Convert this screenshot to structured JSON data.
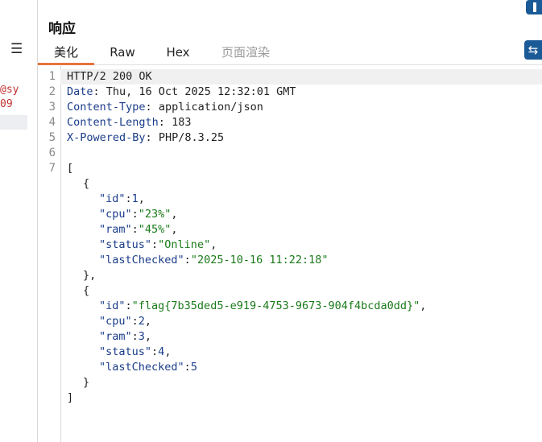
{
  "left_panel": {
    "menu_icon": "☰",
    "fragment_1": "@sy",
    "fragment_2": "09"
  },
  "header": {
    "title": "响应",
    "tabs": [
      {
        "label": "美化",
        "active": true
      },
      {
        "label": "Raw",
        "active": false
      },
      {
        "label": "Hex",
        "active": false
      },
      {
        "label": "页面渲染",
        "active": false,
        "disabled": true
      }
    ]
  },
  "accent_color": "#e8743b",
  "button_color": "#1a5a96",
  "editor": {
    "line_numbers": [
      "1",
      "2",
      "3",
      "4",
      "5",
      "6",
      "7"
    ],
    "headers": [
      {
        "name": "HTTP/2 200 OK",
        "value": ""
      },
      {
        "name": "Date",
        "value": "Thu, 16 Oct 2025 12:32:01 GMT"
      },
      {
        "name": "Content-Type",
        "value": "application/json"
      },
      {
        "name": "Content-Length",
        "value": "183"
      },
      {
        "name": "X-Powered-By",
        "value": "PHP/8.3.25"
      }
    ],
    "body": {
      "open_bracket": "[",
      "close_bracket": "]",
      "open_brace": "{",
      "close_brace_comma": "},",
      "close_brace": "}",
      "items": [
        {
          "id_key": "\"id\"",
          "id_val": "1",
          "cpu_key": "\"cpu\"",
          "cpu_val": "\"23%\"",
          "ram_key": "\"ram\"",
          "ram_val": "\"45%\"",
          "status_key": "\"status\"",
          "status_val": "\"Online\"",
          "lc_key": "\"lastChecked\"",
          "lc_val": "\"2025-10-16 11:22:18\""
        },
        {
          "id_key": "\"id\"",
          "id_val": "\"flag{7b35ded5-e919-4753-9673-904f4bcda0dd}\"",
          "cpu_key": "\"cpu\"",
          "cpu_val": "2",
          "ram_key": "\"ram\"",
          "ram_val": "3",
          "status_key": "\"status\"",
          "status_val": "4",
          "lc_key": "\"lastChecked\"",
          "lc_val": "5"
        }
      ]
    }
  }
}
